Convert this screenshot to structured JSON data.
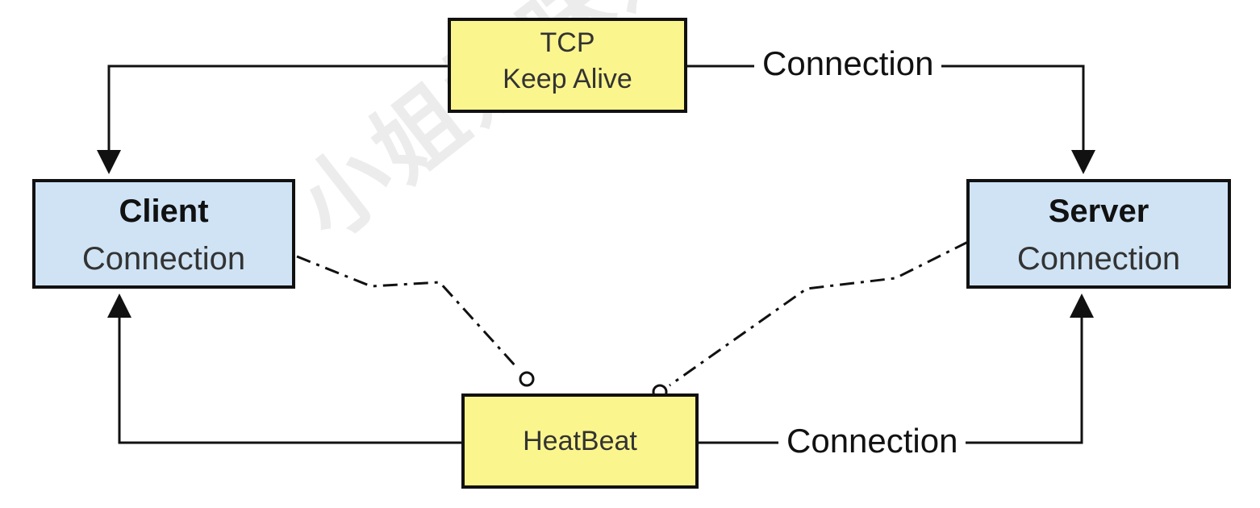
{
  "diagram": {
    "tcp_box": {
      "line1": "TCP",
      "line2": "Keep Alive"
    },
    "client_box": {
      "title": "Client",
      "subtitle": "Connection"
    },
    "server_box": {
      "title": "Server",
      "subtitle": "Connection"
    },
    "heartbeat_box": {
      "label": "HeatBeat"
    },
    "top_connection_label": "Connection",
    "bottom_connection_label": "Connection",
    "watermark": "小姐姐味道",
    "colors": {
      "yellow_box": "#fbf58d",
      "blue_box": "#cfe3f5",
      "stroke": "#111111"
    }
  }
}
